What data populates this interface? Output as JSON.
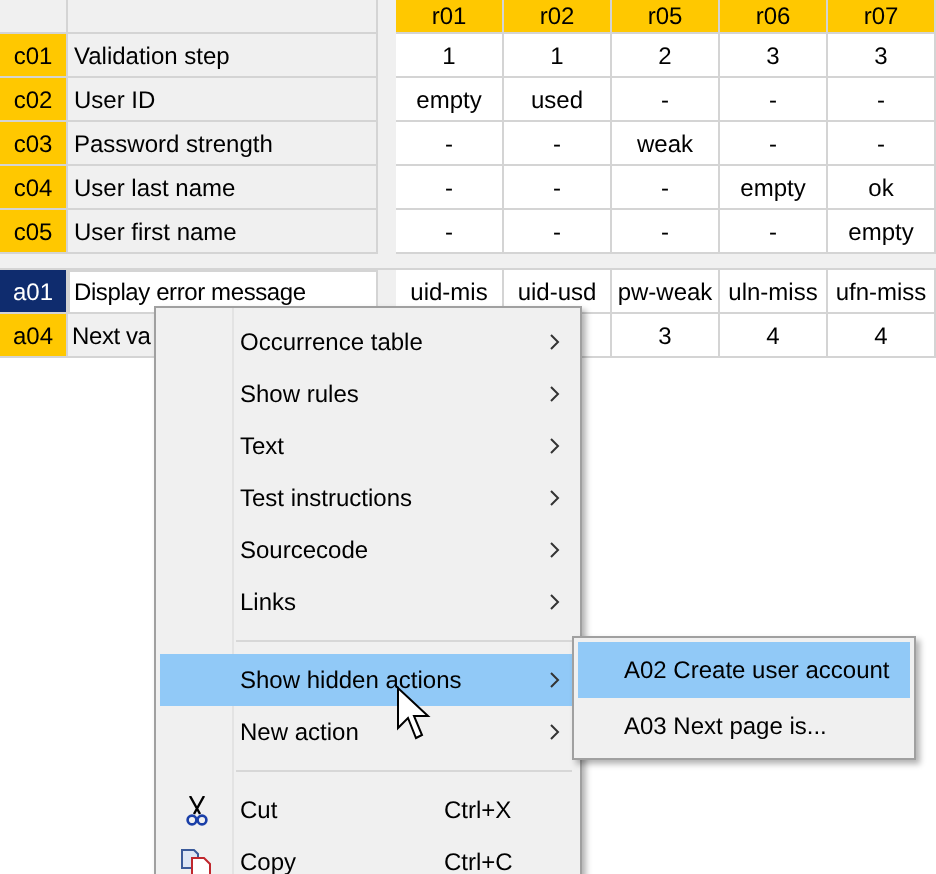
{
  "table": {
    "columns": [
      "r01",
      "r02",
      "r05",
      "r06",
      "r07"
    ],
    "conditions": [
      {
        "id": "c01",
        "label": "Validation step",
        "values": [
          "1",
          "1",
          "2",
          "3",
          "3"
        ]
      },
      {
        "id": "c02",
        "label": "User ID",
        "values": [
          "empty",
          "used",
          "-",
          "-",
          "-"
        ]
      },
      {
        "id": "c03",
        "label": "Password strength",
        "values": [
          "-",
          "-",
          "weak",
          "-",
          "-"
        ]
      },
      {
        "id": "c04",
        "label": "User last name",
        "values": [
          "-",
          "-",
          "-",
          "empty",
          "ok"
        ]
      },
      {
        "id": "c05",
        "label": "User first name",
        "values": [
          "-",
          "-",
          "-",
          "-",
          "empty"
        ]
      }
    ],
    "actions": [
      {
        "id": "a01",
        "label": "Display error message",
        "selected": true,
        "values": [
          "uid-mis",
          "uid-usd",
          "pw-weak",
          "uln-miss",
          "ufn-miss"
        ]
      },
      {
        "id": "a04",
        "label": "Next va",
        "selected": false,
        "values": [
          "3",
          "4",
          "4"
        ]
      }
    ]
  },
  "context_menu": {
    "groups": [
      [
        {
          "kind": "submenu",
          "label": "Occurrence table",
          "selected": false
        },
        {
          "kind": "submenu",
          "label": "Show rules",
          "selected": false
        },
        {
          "kind": "submenu",
          "label": "Text",
          "selected": false
        },
        {
          "kind": "submenu",
          "label": "Test instructions",
          "selected": false
        },
        {
          "kind": "submenu",
          "label": "Sourcecode",
          "selected": false
        },
        {
          "kind": "submenu",
          "label": "Links",
          "selected": false
        }
      ],
      [
        {
          "kind": "submenu",
          "label": "Show hidden actions",
          "selected": true
        },
        {
          "kind": "submenu",
          "label": "New action",
          "selected": false
        }
      ],
      [
        {
          "kind": "command",
          "label": "Cut",
          "shortcut": "Ctrl+X",
          "selected": false
        },
        {
          "kind": "command",
          "label": "Copy",
          "shortcut": "Ctrl+C",
          "selected": false
        }
      ]
    ]
  },
  "submenu": {
    "items": [
      {
        "label": "A02 Create user account",
        "selected": true
      },
      {
        "label": "A03 Next page is...",
        "selected": false
      }
    ]
  }
}
